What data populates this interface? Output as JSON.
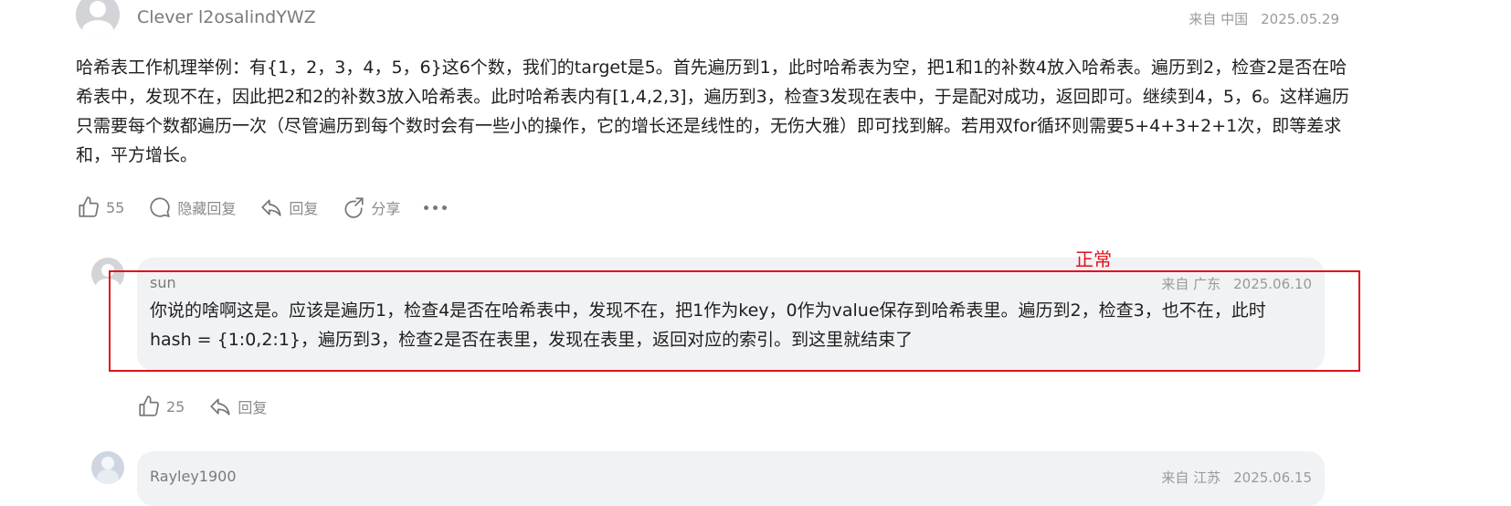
{
  "comment": {
    "username": "Clever l2osalindYWZ",
    "location": "来自 中国",
    "date": "2025.05.29",
    "text": "哈希表工作机理举例：有{1，2，3，4，5，6}这6个数，我们的target是5。首先遍历到1，此时哈希表为空，把1和1的补数4放入哈希表。遍历到2，检查2是否在哈希表中，发现不在，因此把2和2的补数3放入哈希表。此时哈希表内有[1,4,2,3]，遍历到3，检查3发现在表中，于是配对成功，返回即可。继续到4，5，6。这样遍历只需要每个数都遍历一次（尽管遍历到每个数时会有一些小的操作，它的增长还是线性的，无伤大雅）即可找到解。若用双for循环则需要5+4+3+2+1次，即等差求和，平方增长。",
    "likes": "55",
    "hide_replies": "隐藏回复",
    "reply": "回复",
    "share": "分享"
  },
  "replies": [
    {
      "username": "sun",
      "location": "来自 广东",
      "date": "2025.06.10",
      "text": "你说的啥啊这是。应该是遍历1，检查4是否在哈希表中，发现不在，把1作为key，0作为value保存到哈希表里。遍历到2，检查3，也不在，此时hash = {1:0,2:1}，遍历到3，检查2是否在表里，发现在表里，返回对应的索引。到这里就结束了",
      "likes": "25",
      "reply": "回复"
    },
    {
      "username": "Rayley1900",
      "location": "来自 江苏",
      "date": "2025.06.15"
    }
  ],
  "annotation": {
    "label": "正常",
    "color": "#e0121b"
  }
}
